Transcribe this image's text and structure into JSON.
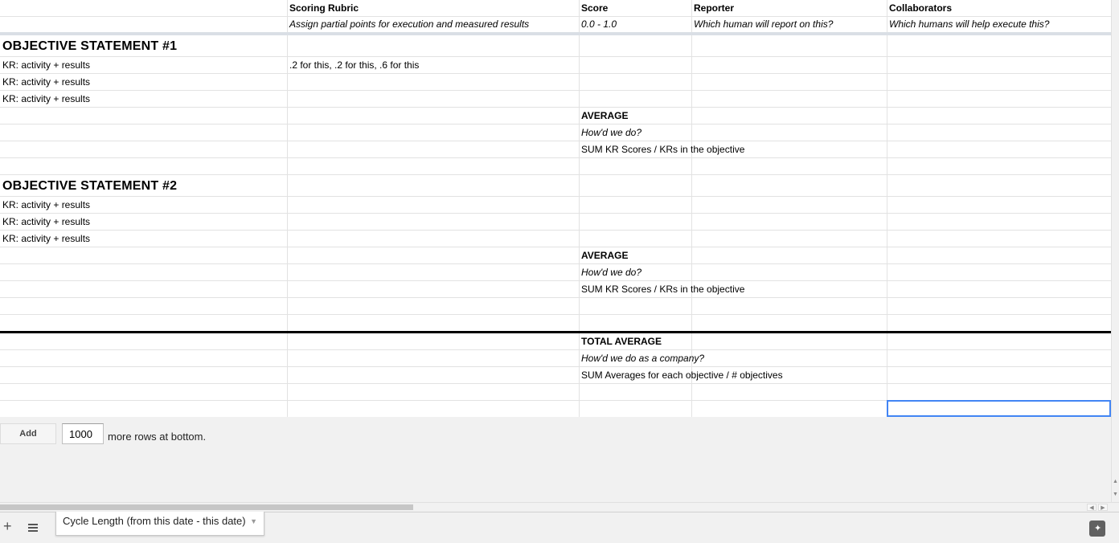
{
  "columns": [
    {
      "title": "",
      "subtitle": ""
    },
    {
      "title": "Scoring Rubric",
      "subtitle": "Assign partial points for execution and measured results"
    },
    {
      "title": "Score",
      "subtitle": "0.0 - 1.0"
    },
    {
      "title": "Reporter",
      "subtitle": "Which human will report on this?"
    },
    {
      "title": "Collaborators",
      "subtitle": "Which humans will help execute this?"
    }
  ],
  "objectives": [
    {
      "title": "OBJECTIVE STATEMENT #1",
      "krs": [
        {
          "label": "KR: activity + results",
          "rubric": ".2 for this, .2 for this, .6 for this"
        },
        {
          "label": "KR: activity + results",
          "rubric": ""
        },
        {
          "label": "KR: activity + results",
          "rubric": ""
        }
      ],
      "average": {
        "label": "AVERAGE",
        "question": "How'd we do?",
        "formula": "SUM KR Scores / KRs in the objective"
      }
    },
    {
      "title": "OBJECTIVE STATEMENT #2",
      "krs": [
        {
          "label": "KR: activity + results",
          "rubric": ""
        },
        {
          "label": "KR: activity + results",
          "rubric": ""
        },
        {
          "label": "KR: activity + results",
          "rubric": ""
        }
      ],
      "average": {
        "label": "AVERAGE",
        "question": "How'd we do?",
        "formula": "SUM KR Scores / KRs in the objective"
      }
    }
  ],
  "total": {
    "label": "TOTAL AVERAGE",
    "question": "How'd we do as a company?",
    "formula": "SUM Averages for each objective / # objectives"
  },
  "add_rows": {
    "button_label": "Add",
    "count_value": "1000",
    "suffix": "more rows at bottom."
  },
  "sheet_bar": {
    "add_sheet_icon": "plus-icon",
    "all_sheets_icon": "menu-icon",
    "tab_label": "Cycle Length (from this date - this date)",
    "explore_icon": "explore-icon"
  },
  "colors": {
    "selection": "#4285f4",
    "grid_line": "#e2e2e2",
    "background": "#f1f1f1"
  }
}
